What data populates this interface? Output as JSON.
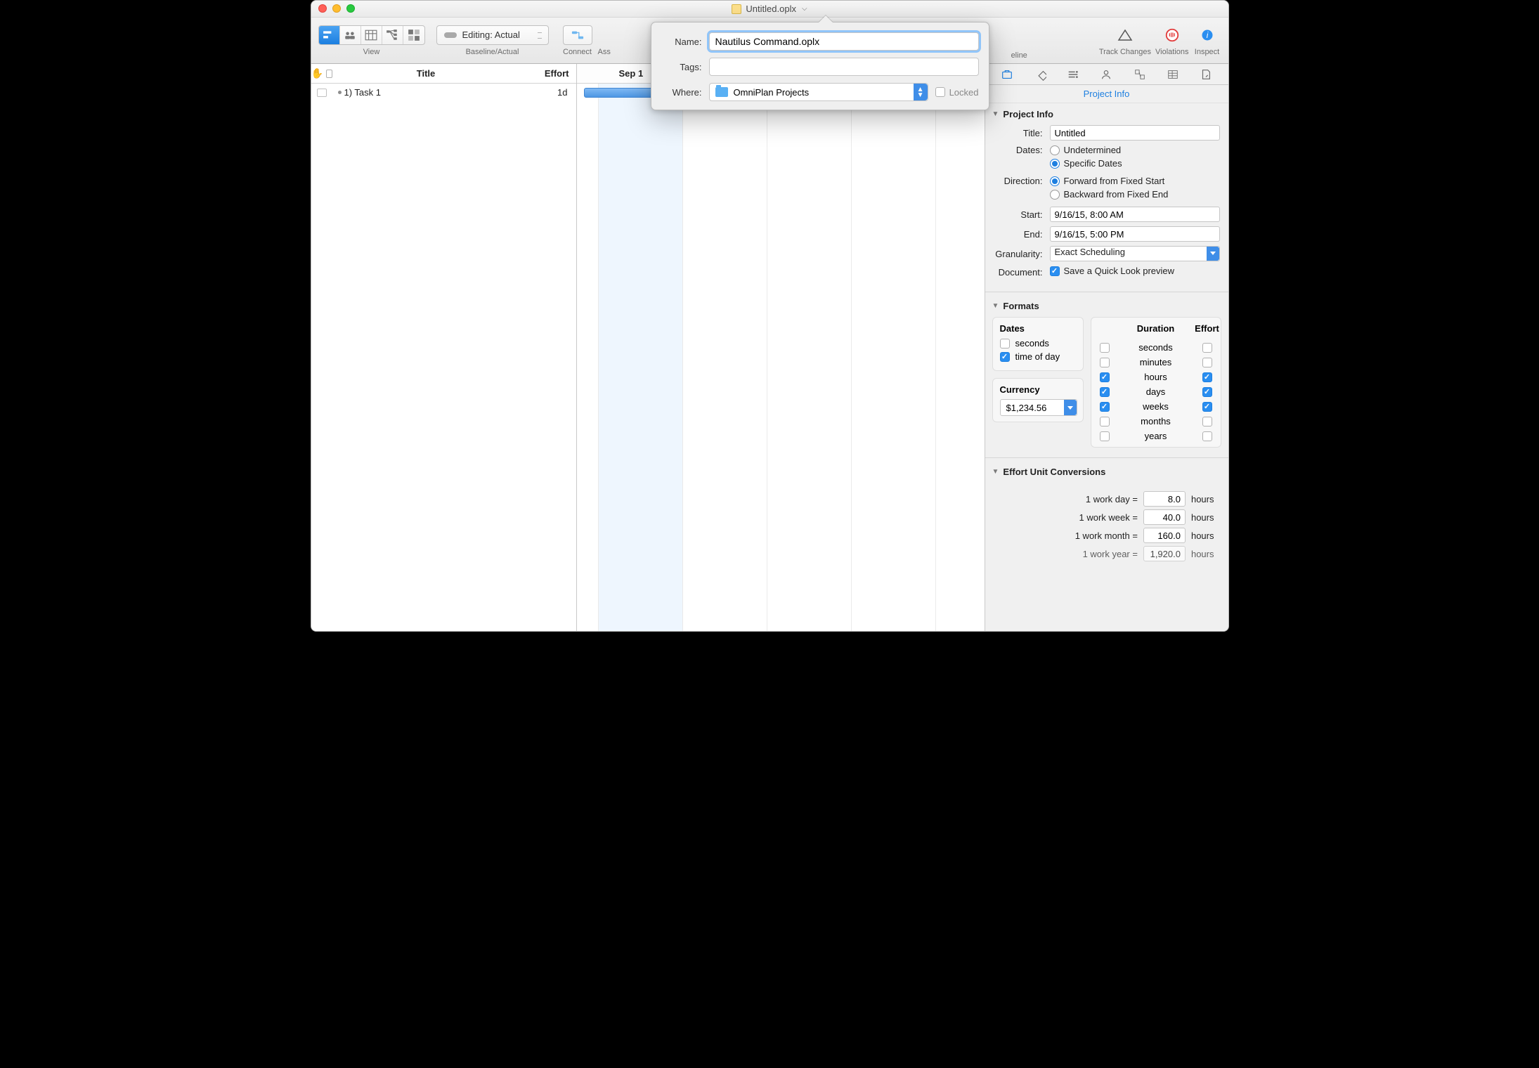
{
  "window": {
    "title": "Untitled.oplx"
  },
  "toolbar": {
    "view_label": "View",
    "baseline_label": "Baseline/Actual",
    "baseline_popup": "Editing: Actual",
    "connect_label": "Connect",
    "assign_partial": "Ass",
    "right": {
      "track": "Track Changes",
      "violations": "Violations",
      "inspect": "Inspect"
    },
    "partial_eline": "eline"
  },
  "popover": {
    "name_label": "Name:",
    "name_value": "Nautilus Command.oplx",
    "tags_label": "Tags:",
    "tags_value": "",
    "where_label": "Where:",
    "where_value": "OmniPlan Projects",
    "locked_label": "Locked"
  },
  "outline": {
    "col_title": "Title",
    "col_effort": "Effort",
    "rows": [
      {
        "label": "1)  Task 1",
        "effort": "1d"
      }
    ]
  },
  "gantt": {
    "header": "Sep 1"
  },
  "inspector": {
    "tab_title": "Project Info",
    "project_info": {
      "header": "Project Info",
      "title_label": "Title:",
      "title_value": "Untitled",
      "dates_label": "Dates:",
      "dates_undetermined": "Undetermined",
      "dates_specific": "Specific Dates",
      "direction_label": "Direction:",
      "direction_forward": "Forward from Fixed Start",
      "direction_backward": "Backward from Fixed End",
      "start_label": "Start:",
      "start_value": "9/16/15, 8:00 AM",
      "end_label": "End:",
      "end_value": "9/16/15, 5:00 PM",
      "granularity_label": "Granularity:",
      "granularity_value": "Exact Scheduling",
      "document_label": "Document:",
      "document_check": "Save a Quick Look preview"
    },
    "formats": {
      "header": "Formats",
      "dates_header": "Dates",
      "dates_seconds": "seconds",
      "dates_tod": "time of day",
      "currency_header": "Currency",
      "currency_value": "$1,234.56",
      "duration_header": "Duration",
      "effort_header": "Effort",
      "units": {
        "seconds": "seconds",
        "minutes": "minutes",
        "hours": "hours",
        "days": "days",
        "weeks": "weeks",
        "months": "months",
        "years": "years"
      }
    },
    "conversions": {
      "header": "Effort Unit Conversions",
      "rows": [
        {
          "label": "1 work day =",
          "value": "8.0",
          "unit": "hours"
        },
        {
          "label": "1 work week =",
          "value": "40.0",
          "unit": "hours"
        },
        {
          "label": "1 work month =",
          "value": "160.0",
          "unit": "hours"
        },
        {
          "label": "1 work year =",
          "value": "1,920.0",
          "unit": "hours"
        }
      ]
    }
  }
}
